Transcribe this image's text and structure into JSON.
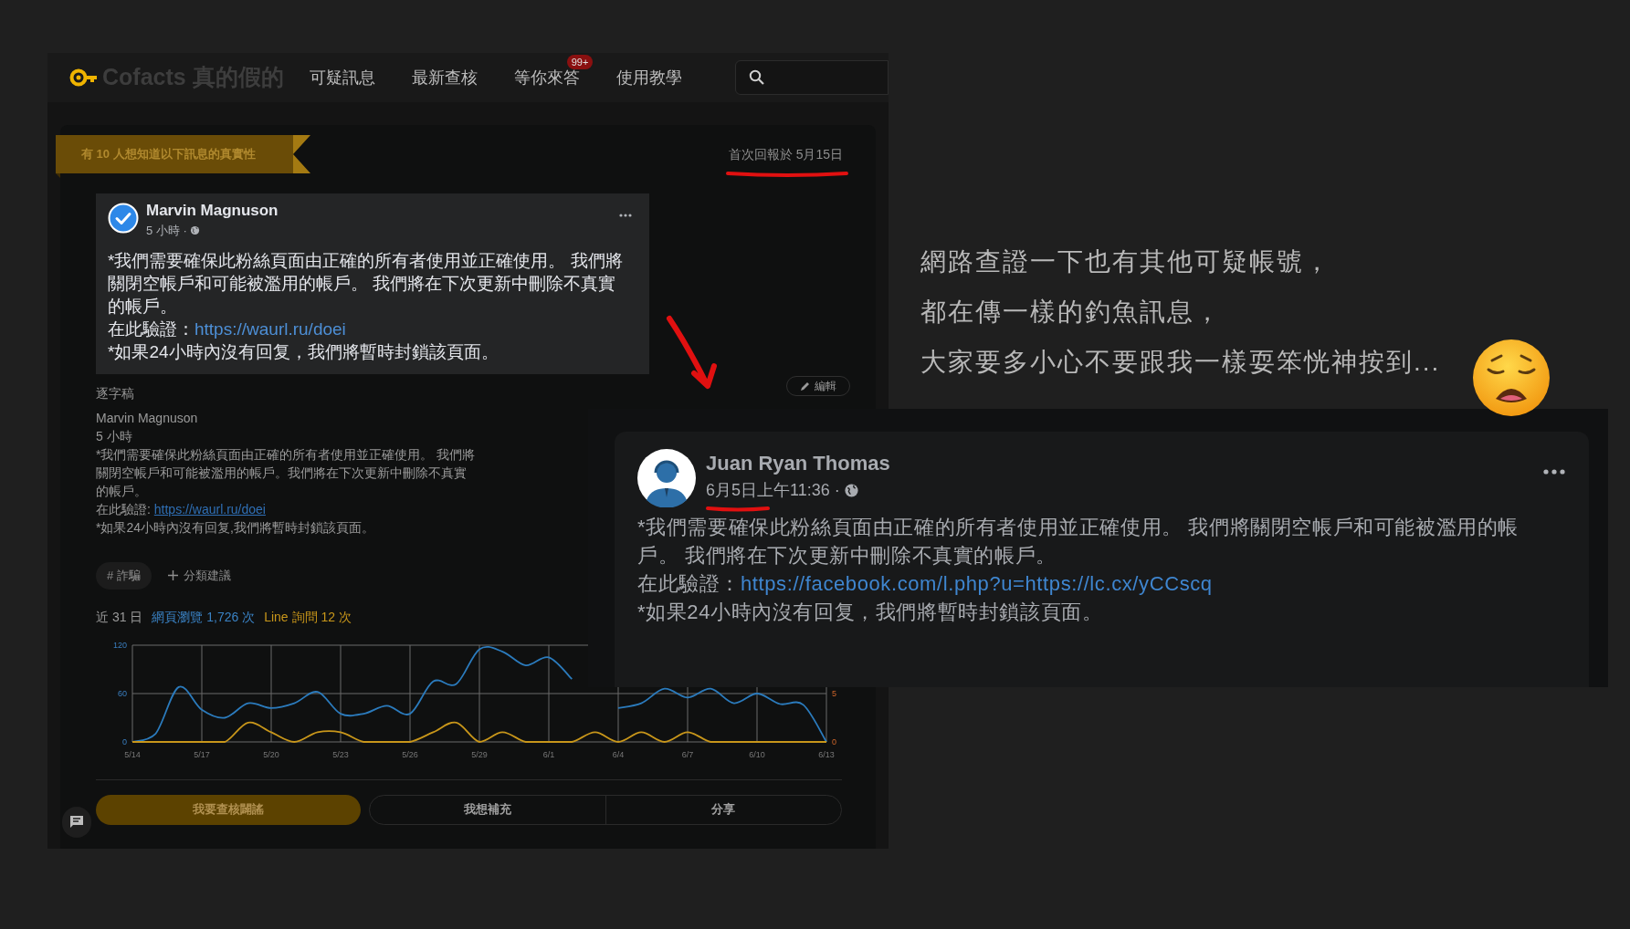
{
  "cofacts": {
    "header": {
      "logo": "Cofacts 真的假的",
      "nav": [
        {
          "label": "可疑訊息"
        },
        {
          "label": "最新查核"
        },
        {
          "label": "等你來答",
          "badge": "99+"
        },
        {
          "label": "使用教學"
        }
      ]
    },
    "ribbon": "有 10 人想知道以下訊息的真實性",
    "first_reported": "首次回報於 5月15日",
    "post": {
      "author": "Marvin Magnuson",
      "time": "5 小時 ·",
      "body": "*我們需要確保此粉絲頁面由正確的所有者使用並正確使用。 我們將關閉空帳戶和可能被濫用的帳戶。 我們將在下次更新中刪除不真實的帳戶。",
      "verify_prefix": "在此驗證：",
      "link": "https://waurl.ru/doei",
      "footer": "*如果24小時內沒有回复，我們將暫時封鎖該頁面。"
    },
    "transcript": {
      "label": "逐字稿",
      "edit": "編輯",
      "author": "Marvin Magnuson",
      "time": "5 小時",
      "body": "*我們需要確保此粉絲頁面由正確的所有者使用並正確使用。 我們將關閉空帳戶和可能被濫用的帳戶。我們將在下次更新中刪除不真實的帳戶。",
      "verify_prefix": "在此驗證: ",
      "link": "https://waurl.ru/doei",
      "footer": "*如果24小時內沒有回复,我們將暫時封鎖該頁面。"
    },
    "tags": [
      {
        "label": "# 詐騙"
      }
    ],
    "suggest_category": "分類建議",
    "stats": {
      "period": "近 31 日",
      "views": "網頁瀏覽 1,726 次",
      "line": "Line 詢問 12 次"
    },
    "chart_data": {
      "type": "line",
      "categories": [
        "5/14",
        null,
        null,
        "5/17",
        null,
        null,
        "5/20",
        null,
        null,
        "5/23",
        null,
        null,
        "5/26",
        null,
        null,
        "5/29",
        null,
        null,
        "6/1",
        null,
        null,
        "6/4",
        null,
        null,
        "6/7",
        null,
        null,
        "6/10",
        null,
        null,
        "6/13"
      ],
      "grid": true,
      "ylim": [
        0,
        120
      ],
      "yticks": [
        0,
        60,
        120
      ],
      "y2lim": [
        0,
        10
      ],
      "y2ticks": [
        0,
        5
      ],
      "series": [
        {
          "color": "#2b7bbd",
          "values": [
            0,
            10,
            68,
            40,
            30,
            48,
            42,
            48,
            62,
            35,
            35,
            45,
            35,
            75,
            72,
            115,
            112,
            95,
            105,
            78,
            null,
            42,
            48,
            66,
            55,
            66,
            48,
            60,
            47,
            46,
            0
          ]
        },
        {
          "color": "#c8961a",
          "axis": "y2",
          "values": [
            0,
            0,
            0,
            0,
            0,
            2,
            1,
            0,
            1,
            1,
            0,
            0,
            0,
            1,
            2,
            0,
            1,
            0,
            0,
            0,
            1,
            0,
            1,
            0,
            1,
            0,
            0,
            0,
            0,
            0,
            0
          ]
        }
      ]
    },
    "actions": [
      {
        "label": "我要查核闢謠",
        "primary": true
      },
      {
        "label": "我想補充",
        "primary": false
      },
      {
        "label": "分享",
        "primary": false
      }
    ]
  },
  "facebook_post": {
    "author": "Juan Ryan Thomas",
    "time": "6月5日上午11:36 ·",
    "body": "*我們需要確保此粉絲頁面由正確的所有者使用並正確使用。 我們將關閉空帳戶和可能被濫用的帳戶。 我們將在下次更新中刪除不真實的帳戶。",
    "verify_prefix": "在此驗證：",
    "link": "https://facebook.com/l.php?u=https://lc.cx/yCCscq",
    "footer": "*如果24小時內沒有回复，我們將暫時封鎖該頁面。"
  },
  "note": {
    "lines": [
      "網路查證一下也有其他可疑帳號，",
      "都在傳一樣的釣魚訊息，",
      "大家要多小心不要跟我一樣耍笨恍神按到..."
    ]
  }
}
